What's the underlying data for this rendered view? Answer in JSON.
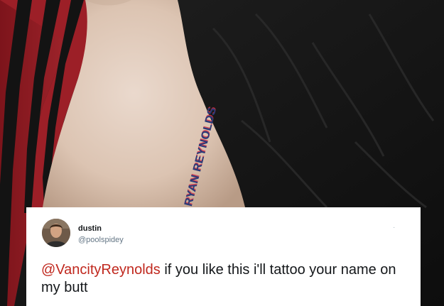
{
  "tattoo": {
    "text": "RYAN REYNOLDS"
  },
  "tweet": {
    "author_name": "dustin",
    "author_handle": "@poolspidey",
    "menu_icon": "ellipsis-dot",
    "mention": "@VancityReynolds",
    "body": " if you like this i'll tattoo your name on my butt"
  },
  "colors": {
    "mention": "#c0281e",
    "tattoo_ink": "#2a3a78",
    "shirt_red": "#8e1c23",
    "shirt_black": "#141414"
  }
}
